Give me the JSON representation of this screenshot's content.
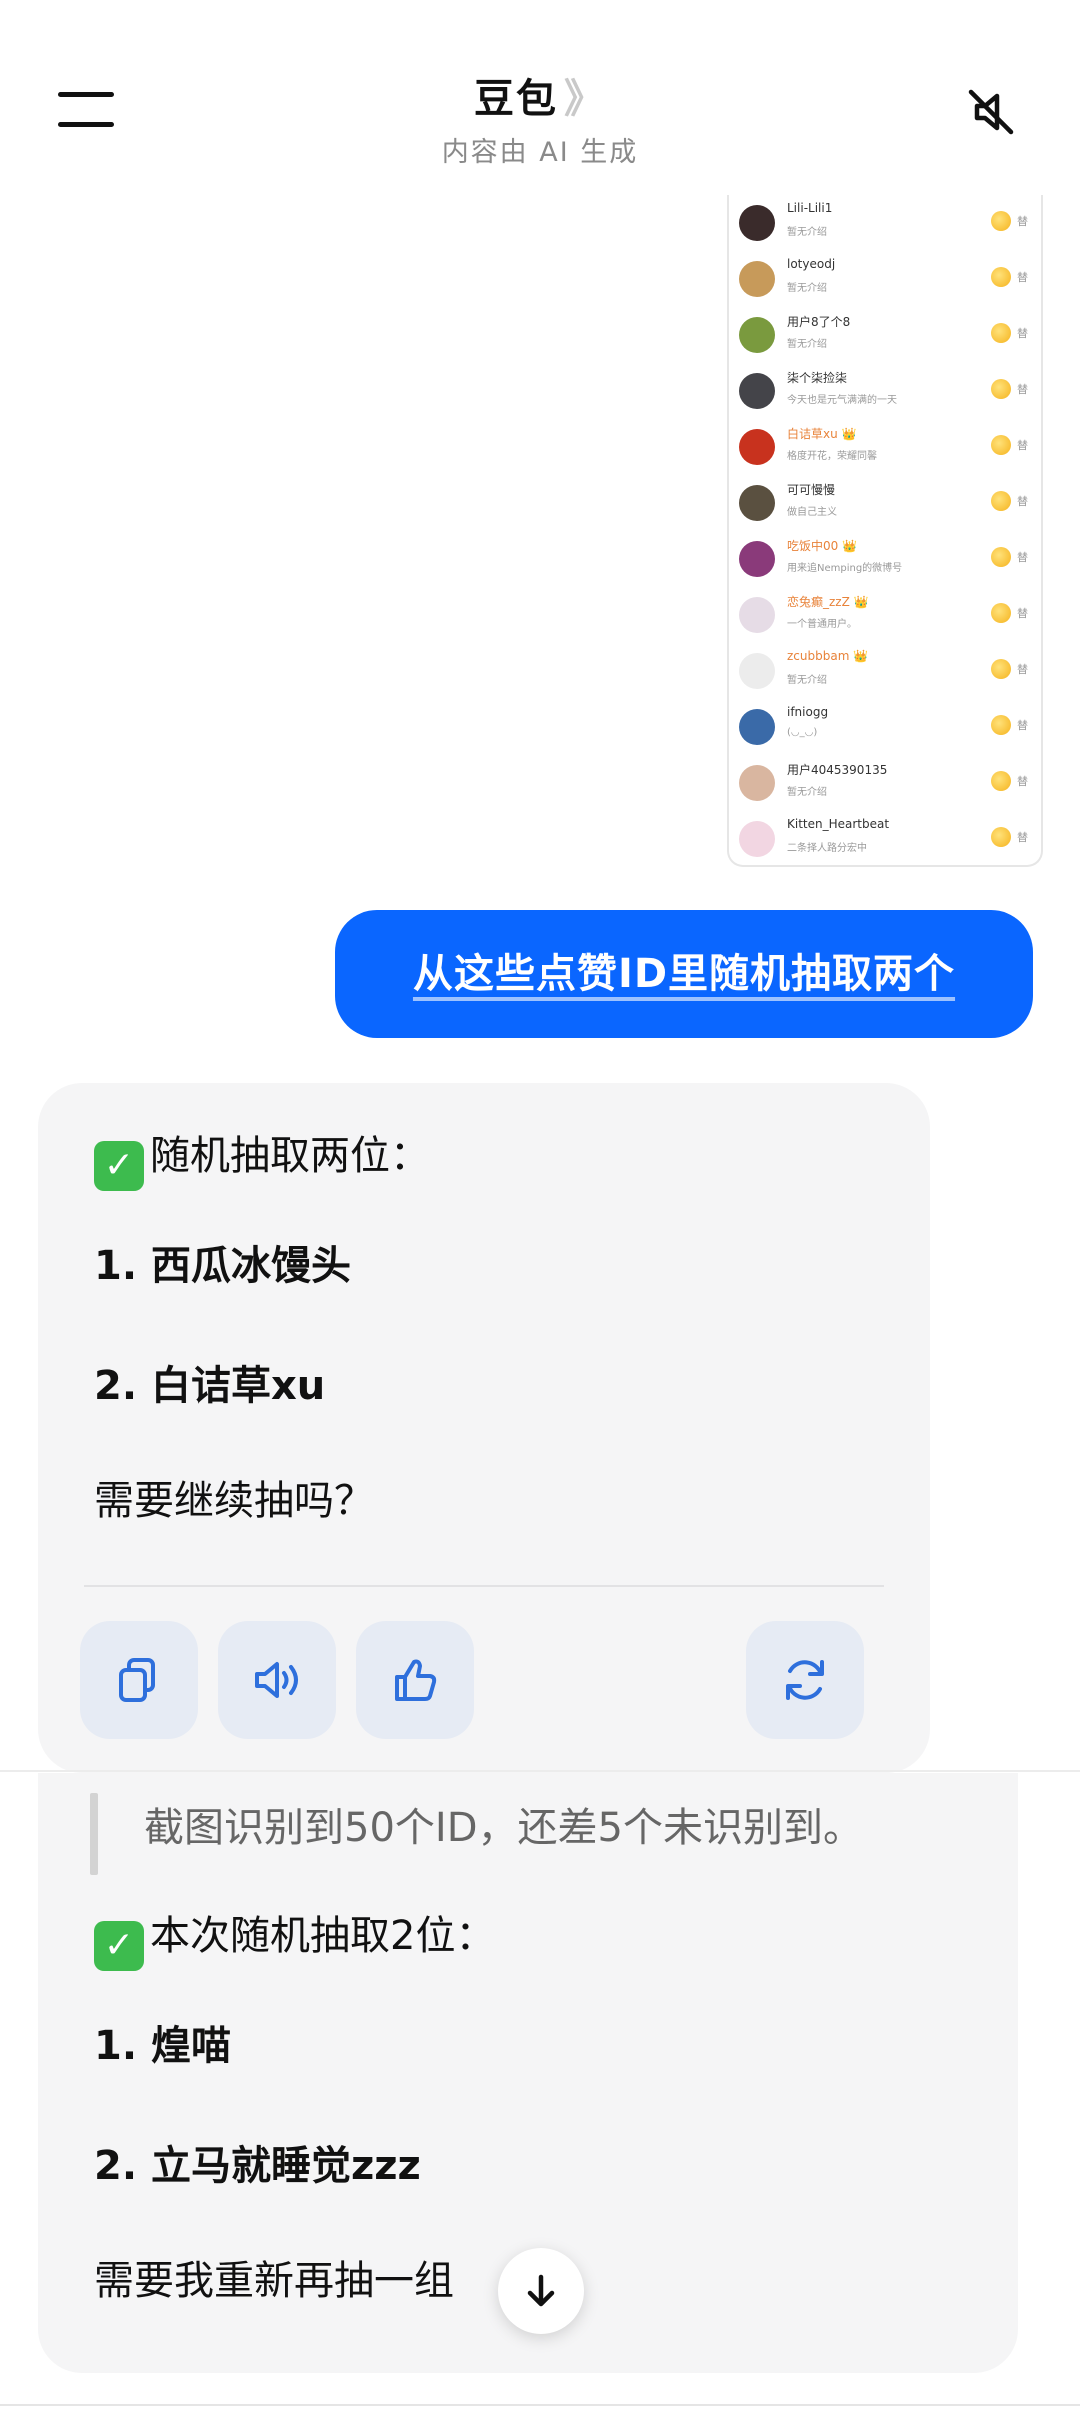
{
  "header": {
    "title": "豆包",
    "chevron": "》",
    "subtitle": "内容由 AI 生成",
    "menu_icon": "hamburger-menu-icon",
    "mute_icon": "speaker-muted-icon"
  },
  "screenshot": {
    "items": [
      {
        "name": "Lili-Lili1",
        "desc": "暂无介绍",
        "vip": false,
        "avatar": "#3a2b2b"
      },
      {
        "name": "lotyeodj",
        "desc": "暂无介绍",
        "vip": false,
        "avatar": "#c79a5a"
      },
      {
        "name": "用户8了个8",
        "desc": "暂无介绍",
        "vip": false,
        "avatar": "#7a9a3e"
      },
      {
        "name": "柒个柒捡柒",
        "desc": "今天也是元气满满的一天",
        "vip": false,
        "avatar": "#444449"
      },
      {
        "name": "白诘草xu 👑",
        "desc": "格度开花，荣耀同馨",
        "vip": true,
        "avatar": "#c8321e"
      },
      {
        "name": "可可慢慢",
        "desc": "做自己主义",
        "vip": false,
        "avatar": "#5a5040"
      },
      {
        "name": "吃饭中00 👑",
        "desc": "用来追Nemping的微博号",
        "vip": true,
        "avatar": "#8a3a7a"
      },
      {
        "name": "恋兔癫_zzZ 👑",
        "desc": "一个普通用户。",
        "vip": true,
        "avatar": "#e6dce6"
      },
      {
        "name": "zcubbbam 👑",
        "desc": "暂无介绍",
        "vip": true,
        "avatar": "#ececec"
      },
      {
        "name": "ifniogg",
        "desc": "(◡_◡)",
        "vip": false,
        "avatar": "#3a6aa8"
      },
      {
        "name": "用户4045390135",
        "desc": "暂无介绍",
        "vip": false,
        "avatar": "#d9b6a0"
      },
      {
        "name": "Kitten_Heartbeat",
        "desc": "二条择人路分宏中",
        "vip": false,
        "avatar": "#f2d6e2"
      }
    ],
    "coin_icon": "coin-icon",
    "more_label": "替"
  },
  "user_message": "从这些点赞ID里随机抽取两个",
  "reply1": {
    "check_icon": "check-mark-icon",
    "heading": "随机抽取两位：",
    "item1": "1. 西瓜冰馒头",
    "item2": "2. 白诘草xu",
    "question": "需要继续抽吗？"
  },
  "actions": {
    "copy_icon": "copy-icon",
    "speak_icon": "speaker-icon",
    "like_icon": "thumbs-up-icon",
    "regenerate_icon": "refresh-icon"
  },
  "reply2": {
    "quote": "截图识别到50个ID，还差5个未识别到。",
    "check_icon": "check-mark-icon",
    "heading": "本次随机抽取2位：",
    "item1": "1. 煌喵",
    "item2": "2. 立马就睡觉zzz",
    "question": "需要我重新再抽一组"
  },
  "scroll_down_icon": "arrow-down-icon",
  "colors": {
    "accent": "#0a66ff",
    "check": "#3dbb4e",
    "card": "#f5f5f6",
    "action_bg": "#e6ebf4",
    "action_icon": "#2e6fdc"
  }
}
